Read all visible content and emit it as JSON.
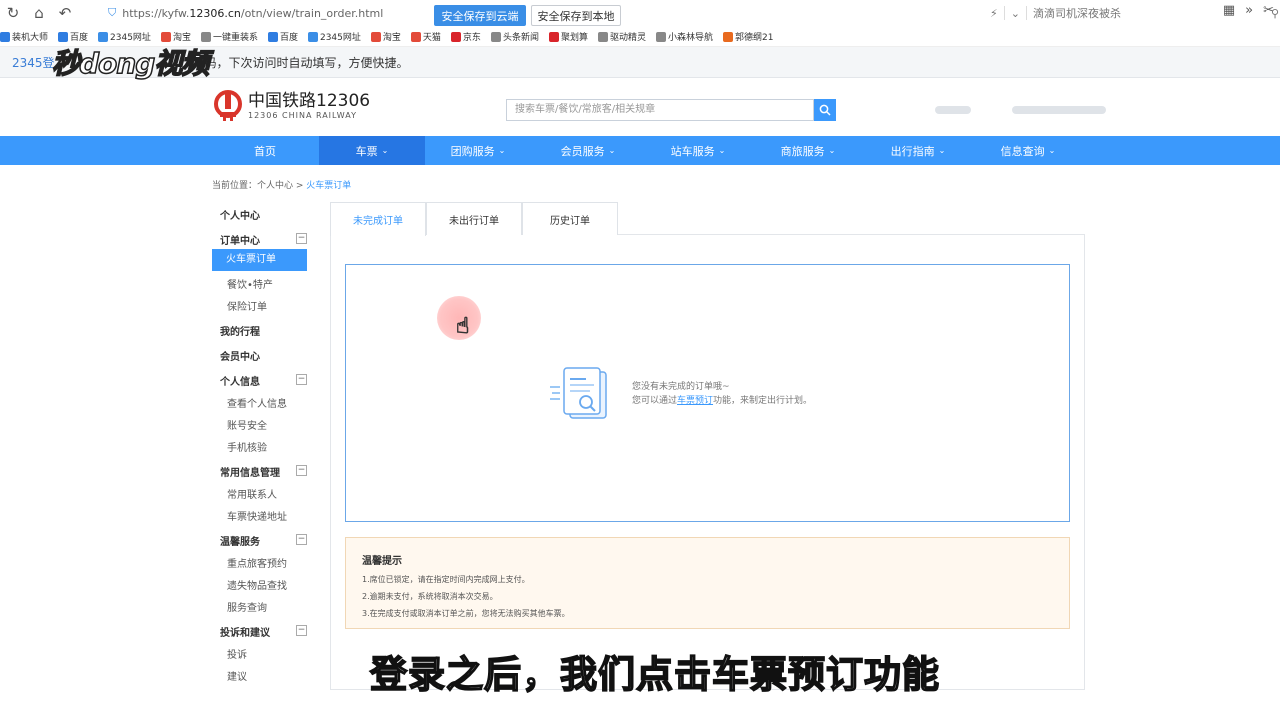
{
  "browser": {
    "url_prefix": "https://kyfw.",
    "url_domain": "12306.cn",
    "url_path": "/otn/view/train_order.html",
    "search_hint": "滴滴司机深夜被杀",
    "bookmarks": [
      "装机大师",
      "百度",
      "2345网址",
      "淘宝",
      "一键重装系",
      "百度",
      "2345网址",
      "淘宝",
      "天猫",
      "京东",
      "头条新闻",
      "聚划算",
      "驱动精灵",
      "小森林导航",
      "郭德纲21"
    ]
  },
  "savebar": {
    "message_start": "2345登",
    "message_end": "码，下次访问时自动填写，方便快捷。",
    "save_cloud": "安全保存到云端",
    "save_local": "安全保存到本地"
  },
  "watermark": "秒dong视频",
  "site": {
    "logo_cn": "中国铁路12306",
    "logo_en": "12306 CHINA RAILWAY",
    "search_placeholder": "搜索车票/餐饮/常旅客/相关规章"
  },
  "nav": [
    "首页",
    "车票",
    "团购服务",
    "会员服务",
    "站车服务",
    "商旅服务",
    "出行指南",
    "信息查询"
  ],
  "nav_caret": "⌄",
  "breadcrumb": {
    "prefix": "当前位置：个人中心 > ",
    "current": "火车票订单"
  },
  "sidebar": {
    "personal_center": "个人中心",
    "order_center": "订单中心",
    "train_orders": "火车票订单",
    "catering": "餐饮•特产",
    "insurance": "保险订单",
    "my_trips": "我的行程",
    "member_center": "会员中心",
    "personal_info": "个人信息",
    "view_info": "查看个人信息",
    "account_security": "账号安全",
    "phone_verify": "手机核验",
    "common_info": "常用信息管理",
    "contacts": "常用联系人",
    "delivery_address": "车票快递地址",
    "warm_service": "温馨服务",
    "key_passenger": "重点旅客预约",
    "lost_items": "遗失物品查找",
    "service_query": "服务查询",
    "complaints": "投诉和建议",
    "complain": "投诉",
    "suggest": "建议",
    "toggle": "−"
  },
  "tabs": [
    "未完成订单",
    "未出行订单",
    "历史订单"
  ],
  "empty": {
    "line1": "您没有未完成的订单哦~",
    "line2_pre": "您可以通过",
    "line2_link": "车票预订",
    "line2_post": "功能，来制定出行计划。"
  },
  "tips": {
    "title": "温馨提示",
    "lines": [
      "1.席位已锁定，请在指定时间内完成网上支付。",
      "2.逾期未支付，系统将取消本次交易。",
      "3.在完成支付或取消本订单之前，您将无法购买其他车票。"
    ]
  },
  "subtitle": "登录之后，我们点击车票预订功能",
  "colors": {
    "primary": "#3b99fc",
    "nav_active": "#2676e3",
    "logo_red": "#d9352b"
  }
}
